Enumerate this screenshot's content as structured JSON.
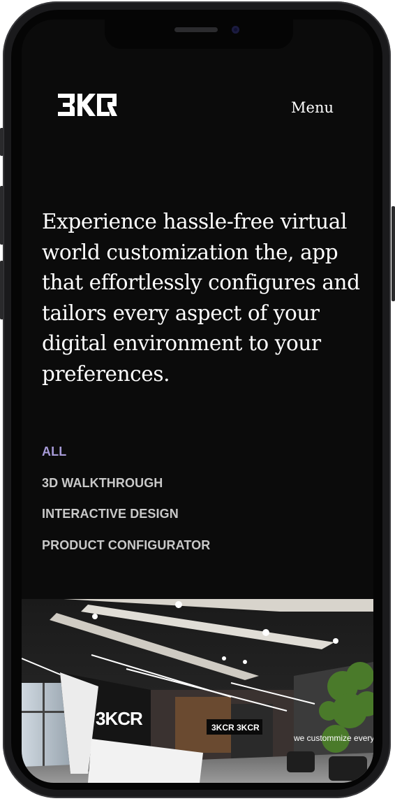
{
  "header": {
    "logo_text": "3KCR",
    "menu_label": "Menu"
  },
  "hero": {
    "text": "Experience hassle-free virtual world customization the, app that effortlessly configures and tailors every aspect of your digital environment to your preferences."
  },
  "filters": [
    {
      "label": "ALL",
      "active": true
    },
    {
      "label": "3D WALKTHROUGH",
      "active": false
    },
    {
      "label": "INTERACTIVE DESIGN",
      "active": false
    },
    {
      "label": "PRODUCT CONFIGURATOR",
      "active": false
    }
  ],
  "project_image": {
    "sign_text": "3KCR",
    "monitor_text": "3KCR 3KCR",
    "wall_text": "we custommize everyth"
  },
  "colors": {
    "background": "#0b0b0b",
    "text": "#ffffff",
    "filter_active": "#a79bd8",
    "filter_inactive": "#c9c9c9"
  }
}
